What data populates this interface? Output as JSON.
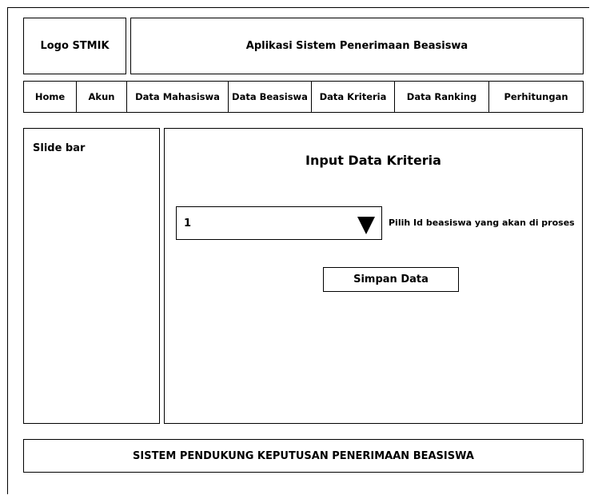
{
  "header": {
    "logo_text": "Logo STMIK",
    "app_title": "Aplikasi Sistem Penerimaan Beasiswa"
  },
  "nav": {
    "items": [
      {
        "label": "Home"
      },
      {
        "label": "Akun"
      },
      {
        "label": "Data Mahasiswa"
      },
      {
        "label": "Data Beasiswa"
      },
      {
        "label": "Data Kriteria"
      },
      {
        "label": "Data Ranking"
      },
      {
        "label": "Perhitungan"
      }
    ]
  },
  "sidebar": {
    "title": "Slide bar"
  },
  "form": {
    "title": "Input Data Kriteria",
    "select_value": "1",
    "select_icon": "triangle-down-icon",
    "select_hint": "Pilih Id beasiswa yang akan di proses",
    "save_label": "Simpan Data"
  },
  "footer": {
    "text": "SISTEM PENDUKUNG KEPUTUSAN PENERIMAAN BEASISWA"
  }
}
